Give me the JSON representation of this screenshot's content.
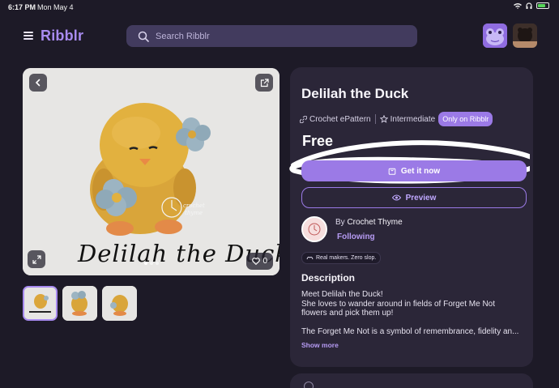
{
  "status_bar": {
    "time": "6:17 PM",
    "date": "Mon May 4"
  },
  "header": {
    "logo": "Ribblr",
    "search_placeholder": "Search Ribblr"
  },
  "gallery": {
    "image_title": "Delilah the Duck",
    "like_count": "0",
    "slide_count": 3,
    "active_slide": 1
  },
  "product": {
    "title": "Delilah the Duck",
    "type": "Crochet ePattern",
    "level": "Intermediate",
    "badge": "Only on Ribblr",
    "price": "Free",
    "get_button": "Get it now",
    "preview_button": "Preview",
    "by_prefix": "By",
    "author": "Crochet Thyme",
    "follow_state": "Following",
    "tagline": "Real makers. Zero slop.",
    "description_heading": "Description",
    "description_lines": [
      "Meet Delilah the Duck!",
      "She loves to wander around in fields of Forget Me Not flowers and pick them up!",
      "The Forget Me Not is a symbol of remembrance, fidelity an..."
    ],
    "show_more": "Show more"
  },
  "colors": {
    "background": "#1d1a27",
    "card": "#2b2638",
    "accent": "#9b7ae6",
    "search": "#423b5e"
  }
}
